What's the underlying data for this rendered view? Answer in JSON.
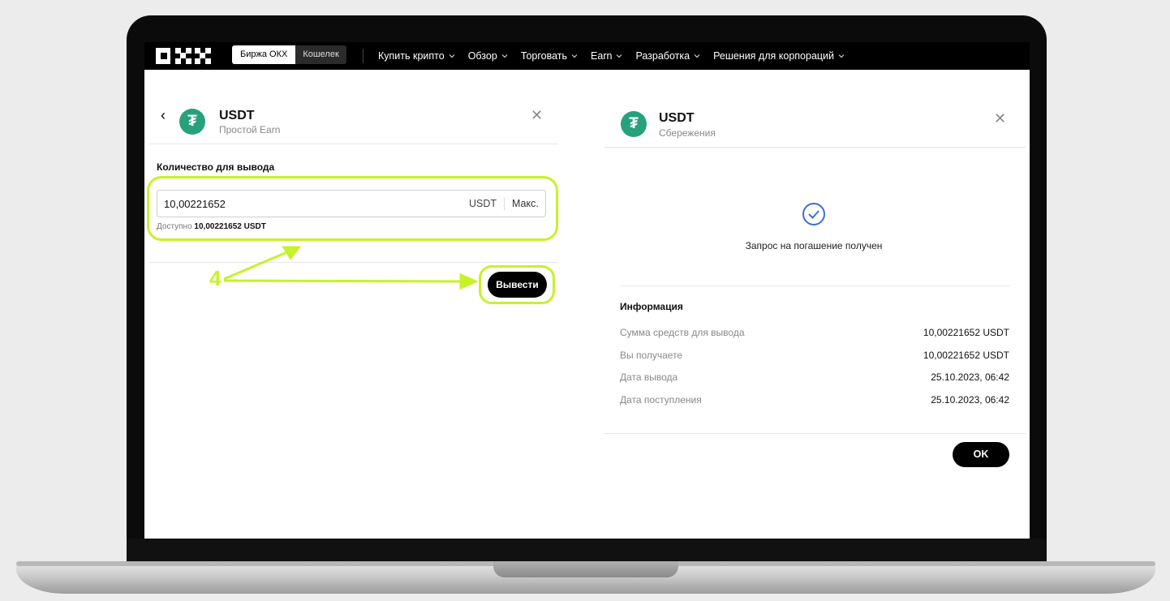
{
  "nav": {
    "exchange_tab": "Биржа ОКХ",
    "wallet_tab": "Кошелек",
    "menu": [
      "Купить крипто",
      "Обзор",
      "Торговать",
      "Earn",
      "Разработка",
      "Решения для корпораций"
    ]
  },
  "left_panel": {
    "coin_symbol": "USDT",
    "coin_subtitle": "Простой Earn",
    "amount_label": "Количество для вывода",
    "amount_value": "10,00221652",
    "currency": "USDT",
    "max_label": "Макс.",
    "available_prefix": "Доступно",
    "available_amount": "10,00221652 USDT",
    "withdraw_button": "Вывести",
    "step_annotation": "4"
  },
  "right_panel": {
    "coin_symbol": "USDT",
    "coin_subtitle": "Сбережения",
    "status_text": "Запрос на погашение получен",
    "info_title": "Информация",
    "rows": [
      {
        "key": "Сумма средств для вывода",
        "value": "10,00221652 USDT"
      },
      {
        "key": "Вы получаете",
        "value": "10,00221652 USDT"
      },
      {
        "key": "Дата вывода",
        "value": "25.10.2023, 06:42"
      },
      {
        "key": "Дата поступления",
        "value": "25.10.2023, 06:42"
      }
    ],
    "ok_button": "OK"
  },
  "colors": {
    "highlight": "#c6f22a",
    "tether": "#26a17b",
    "check": "#3b6fd8"
  }
}
